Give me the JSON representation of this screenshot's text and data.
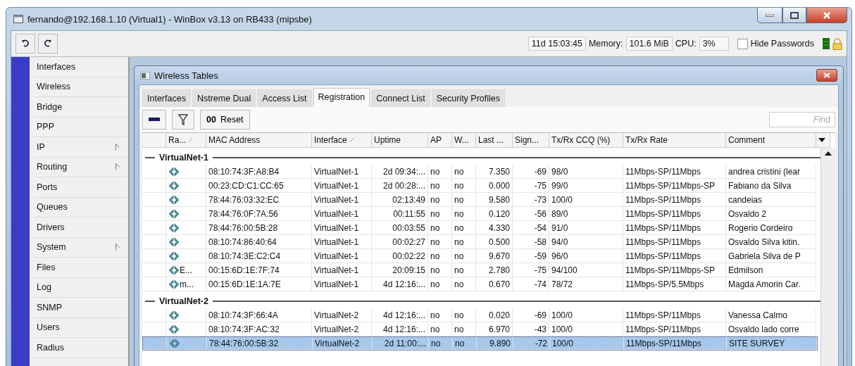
{
  "window": {
    "title": "fernando@192.168.1.10 (Virtual1) - WinBox v3.13 on RB433 (mipsbe)"
  },
  "status": {
    "uptime": "11d 15:03:45",
    "memory_label": "Memory:",
    "memory": "101.6 MiB",
    "cpu_label": "CPU:",
    "cpu": "3%",
    "hide_passwords": {
      "label": "Hide Passwords",
      "checked": false
    }
  },
  "sidebar": {
    "items": [
      {
        "label": "Interfaces",
        "submenu": false
      },
      {
        "label": "Wireless",
        "submenu": false
      },
      {
        "label": "Bridge",
        "submenu": false
      },
      {
        "label": "PPP",
        "submenu": false
      },
      {
        "label": "IP",
        "submenu": true
      },
      {
        "label": "Routing",
        "submenu": true
      },
      {
        "label": "Ports",
        "submenu": false
      },
      {
        "label": "Queues",
        "submenu": false
      },
      {
        "label": "Drivers",
        "submenu": false
      },
      {
        "label": "System",
        "submenu": true
      },
      {
        "label": "Files",
        "submenu": false
      },
      {
        "label": "Log",
        "submenu": false
      },
      {
        "label": "SNMP",
        "submenu": false
      },
      {
        "label": "Users",
        "submenu": false
      },
      {
        "label": "Radius",
        "submenu": false
      }
    ]
  },
  "subwindow": {
    "title": "Wireless Tables",
    "tabs": [
      {
        "label": "Interfaces",
        "selected": false
      },
      {
        "label": "Nstreme Dual",
        "selected": false
      },
      {
        "label": "Access List",
        "selected": false
      },
      {
        "label": "Registration",
        "selected": true
      },
      {
        "label": "Connect List",
        "selected": false
      },
      {
        "label": "Security Profiles",
        "selected": false
      }
    ],
    "toolbar": {
      "reset_icon": "00",
      "reset": "Reset",
      "find_placeholder": "Find"
    },
    "table": {
      "columns": [
        {
          "label": "Ra...",
          "sorted": true
        },
        {
          "label": "MAC Address",
          "sorted": false
        },
        {
          "label": "Interface",
          "sorted": true
        },
        {
          "label": "Uptime",
          "sorted": false
        },
        {
          "label": "AP",
          "sorted": false
        },
        {
          "label": "W...",
          "sorted": false
        },
        {
          "label": "Last ...",
          "sorted": false
        },
        {
          "label": "Sign...",
          "sorted": false
        },
        {
          "label": "Tx/Rx CCQ (%)",
          "sorted": false
        },
        {
          "label": "Tx/Rx Rate",
          "sorted": false
        },
        {
          "label": "Comment",
          "sorted": false
        }
      ],
      "groups": [
        {
          "name": "VirtualNet-1",
          "rows": [
            {
              "selected": false,
              "cells": [
                "",
                "08:10:74:3F:A8:B4",
                "VirtualNet-1",
                "2d 09:34:...",
                "no",
                "no",
                "7.350",
                "-69",
                "98/0",
                "11Mbps-SP/11Mbps",
                "andrea cristini (lear"
              ]
            },
            {
              "selected": false,
              "cells": [
                "",
                "00:23:CD:C1:CC:65",
                "VirtualNet-1",
                "2d 00:28:...",
                "no",
                "no",
                "0.000",
                "-75",
                "99/0",
                "11Mbps-SP/11Mbps-SP",
                "Fabiano da Silva"
              ]
            },
            {
              "selected": false,
              "cells": [
                "",
                "78:44:76:03:32:EC",
                "VirtualNet-1",
                "02:13:49",
                "no",
                "no",
                "9.580",
                "-73",
                "100/0",
                "11Mbps-SP/11Mbps",
                "candeias"
              ]
            },
            {
              "selected": false,
              "cells": [
                "",
                "78:44:76:0F:7A:56",
                "VirtualNet-1",
                "00:11:55",
                "no",
                "no",
                "0.120",
                "-56",
                "89/0",
                "11Mbps-SP/11Mbps",
                "Osvaldo 2"
              ]
            },
            {
              "selected": false,
              "cells": [
                "",
                "78:44:76:00:5B:28",
                "VirtualNet-1",
                "00:03:55",
                "no",
                "no",
                "4.330",
                "-54",
                "91/0",
                "11Mbps-SP/11Mbps",
                "Rogerio Cordeiro"
              ]
            },
            {
              "selected": false,
              "cells": [
                "",
                "08:10:74:86:40:64",
                "VirtualNet-1",
                "00:02:27",
                "no",
                "no",
                "0.500",
                "-58",
                "94/0",
                "11Mbps-SP/11Mbps",
                "Osvaldo Silva kitin."
              ]
            },
            {
              "selected": false,
              "cells": [
                "",
                "08:10:74:3E:C2:C4",
                "VirtualNet-1",
                "00:02:22",
                "no",
                "no",
                "9.670",
                "-59",
                "96/0",
                "11Mbps-SP/11Mbps",
                "Gabriela Silva de P"
              ]
            },
            {
              "selected": false,
              "cells": [
                "E...",
                "00:15:6D:1E:7F:74",
                "VirtualNet-1",
                "20:09:15",
                "no",
                "no",
                "2.780",
                "-75",
                "94/100",
                "11Mbps-SP/11Mbps-SP",
                "Edmilson"
              ]
            },
            {
              "selected": false,
              "cells": [
                "m...",
                "00:15:6D:1E:1A:7E",
                "VirtualNet-1",
                "4d 12:16:...",
                "no",
                "no",
                "0.670",
                "-74",
                "78/72",
                "11Mbps-SP/5.5Mbps",
                "Magda Amorin Car."
              ]
            }
          ]
        },
        {
          "name": "VirtualNet-2",
          "rows": [
            {
              "selected": false,
              "cells": [
                "",
                "08:10:74:3F:66:4A",
                "VirtualNet-2",
                "4d 12:16:...",
                "no",
                "no",
                "0.020",
                "-69",
                "100/0",
                "11Mbps-SP/11Mbps",
                "Vanessa Calmo"
              ]
            },
            {
              "selected": false,
              "cells": [
                "",
                "08:10:74:3F:AC:32",
                "VirtualNet-2",
                "4d 12:16:...",
                "no",
                "no",
                "6.970",
                "-43",
                "100/0",
                "11Mbps-SP/11Mbps",
                "Osvaldo lado corre"
              ]
            },
            {
              "selected": true,
              "cells": [
                "",
                "78:44:76:00:5B:32",
                "VirtualNet-2",
                "2d 11:00:...",
                "no",
                "no",
                "9.890",
                "-72",
                "100/0",
                "11Mbps-SP/11Mbps",
                "SITE SURVEY"
              ]
            }
          ]
        }
      ]
    }
  }
}
